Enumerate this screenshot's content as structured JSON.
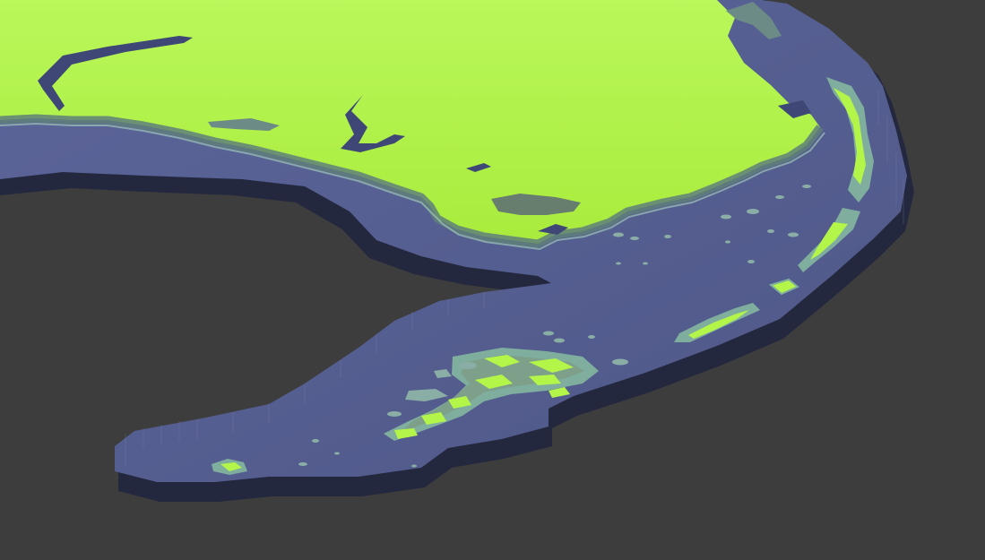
{
  "viewport": {
    "kind": "3d-viewport",
    "background": "#3d3d3d",
    "grid_color": "#4a4a4a",
    "x_axis_color": "#b03434"
  },
  "model": {
    "subject": "terrain-relief-model",
    "land_color": "#b4f54a",
    "land_shadow_color": "#5e7d6a",
    "water_base_color": "#5a6398",
    "water_edge_color": "#252a44",
    "shoreline_color": "#8fb9b0"
  }
}
